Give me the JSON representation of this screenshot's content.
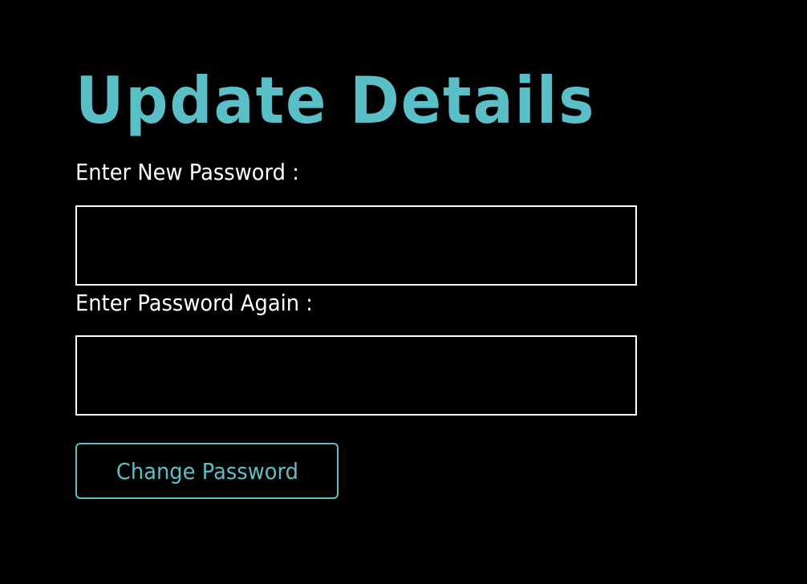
{
  "form": {
    "title": "Update Details",
    "new_password_label": "Enter New Password :",
    "new_password_value": "",
    "confirm_password_label": "Enter Password Again :",
    "confirm_password_value": "",
    "submit_label": "Change Password"
  },
  "colors": {
    "background": "#000000",
    "accent": "#5bbfc8",
    "text": "#ffffff",
    "field_border": "#ffffff"
  }
}
